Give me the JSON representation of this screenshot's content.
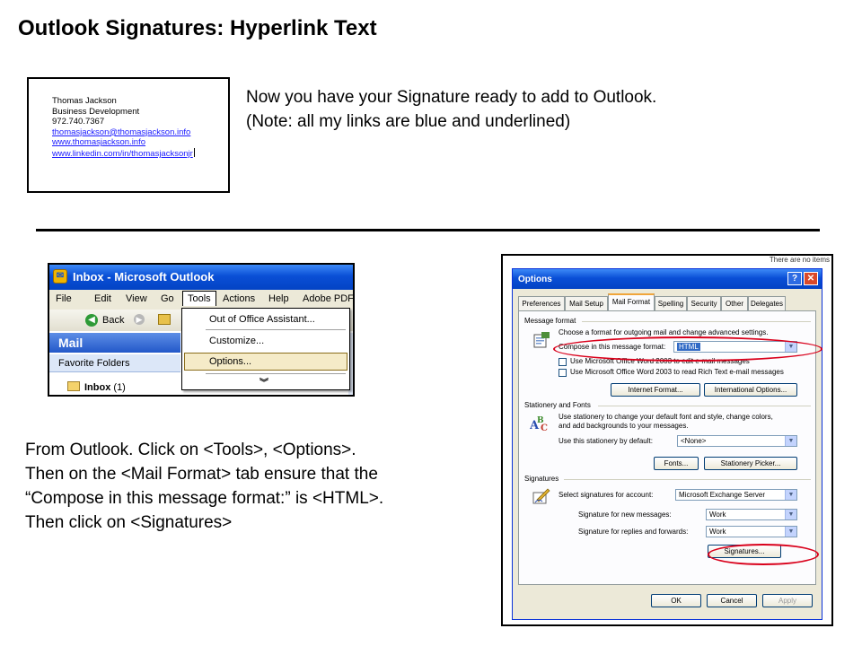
{
  "slide": {
    "title": "Outlook Signatures: Hyperlink Text",
    "intro_line1": "Now you have your Signature ready to add to Outlook.",
    "intro_line2": "(Note: all my links are blue and underlined)",
    "instructions_line1": "From Outlook.  Click on <Tools>, <Options>.",
    "instructions_line2": "Then on the <Mail Format> tab ensure that the",
    "instructions_line3": "“Compose in this message format:” is <HTML>.",
    "instructions_line4": "Then click on <Signatures>"
  },
  "signature": {
    "name": "Thomas Jackson",
    "title": "Business Development",
    "phone": "972.740.7367",
    "email": "thomasjackson@thomasjackson.info",
    "website": "www.thomasjackson.info",
    "linkedin": "www.linkedin.com/in/thomasjacksonjr",
    "link_color": "#1a1aff"
  },
  "outlook": {
    "window_title": "Inbox - Microsoft Outlook",
    "menu": [
      "File",
      "Edit",
      "View",
      "Go",
      "Tools",
      "Actions",
      "Help",
      "Adobe PDF"
    ],
    "toolbar_back": "Back",
    "tools_menu": {
      "out_of_office": "Out of Office Assistant...",
      "customize": "Customize...",
      "options": "Options..."
    },
    "pane_header": "Mail",
    "favorite_folders": "Favorite Folders",
    "inbox_label": "Inbox",
    "inbox_count": "(1)"
  },
  "options_dialog": {
    "top_note": "There are no items",
    "title": "Options",
    "tabs": [
      "Preferences",
      "Mail Setup",
      "Mail Format",
      "Spelling",
      "Security",
      "Other",
      "Delegates"
    ],
    "active_tab": "Mail Format",
    "message_format": {
      "heading": "Message format",
      "description": "Choose a format for outgoing mail and change advanced settings.",
      "compose_label": "Compose in this message format:",
      "compose_value": "HTML",
      "word_edit": "Use Microsoft Office Word 2003 to edit e-mail messages",
      "word_read": "Use Microsoft Office Word 2003 to read Rich Text e-mail messages",
      "internet_format_button": "Internet Format...",
      "international_options_button": "International Options..."
    },
    "stationery": {
      "heading": "Stationery and Fonts",
      "description_line1": "Use stationery to change your default font and style, change colors,",
      "description_line2": "and add backgrounds to your messages.",
      "use_label": "Use this stationery by default:",
      "use_value": "<None>",
      "fonts_button": "Fonts...",
      "stationery_picker_button": "Stationery Picker..."
    },
    "signatures": {
      "heading": "Signatures",
      "account_label": "Select signatures for account:",
      "account_value": "Microsoft Exchange Server",
      "new_label": "Signature for new messages:",
      "new_value": "Work",
      "reply_label": "Signature for replies and forwards:",
      "reply_value": "Work",
      "signatures_button": "Signatures..."
    },
    "ok_button": "OK",
    "cancel_button": "Cancel",
    "apply_button": "Apply",
    "highlight_color": "#d9001b"
  }
}
